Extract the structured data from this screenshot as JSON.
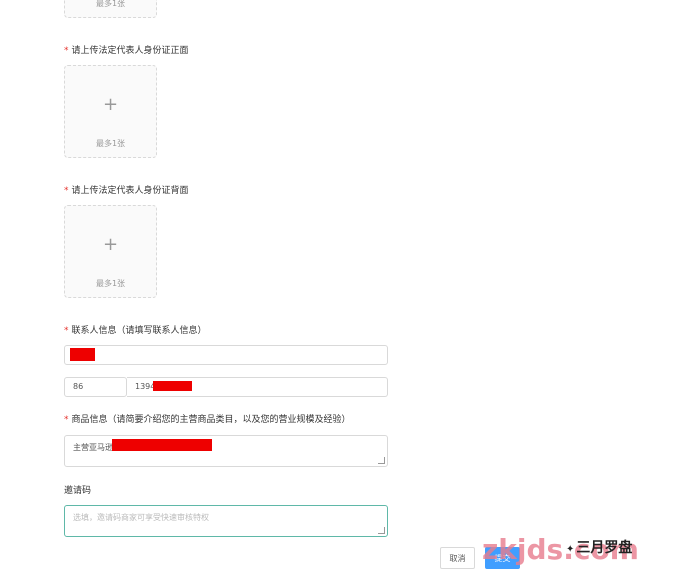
{
  "uploads": [
    {
      "label": "",
      "hint": "最多1张"
    },
    {
      "label": "请上传法定代表人身份证正面",
      "hint": "最多1张"
    },
    {
      "label": "请上传法定代表人身份证背面",
      "hint": "最多1张"
    }
  ],
  "required_mark": "*",
  "contact": {
    "label": "联系人信息（请填写联系人信息）",
    "name_value": "",
    "country_code": "86",
    "phone_value": "1394"
  },
  "product": {
    "label": "商品信息（请简要介绍您的主营商品类目，以及您的营业规模及经验）",
    "value": "主营亚马逊"
  },
  "invite": {
    "label": "邀请码",
    "placeholder": "选填，邀请码商家可享受快速审核特权"
  },
  "buttons": {
    "cancel": "取消",
    "submit": "提交"
  },
  "watermark": {
    "site": "zkjds.com",
    "wechat": "三月罗盘"
  },
  "colors": {
    "required": "#e5322d",
    "primary": "#409eff",
    "redaction": "#ee0000",
    "active_border": "#5fb8a8"
  }
}
